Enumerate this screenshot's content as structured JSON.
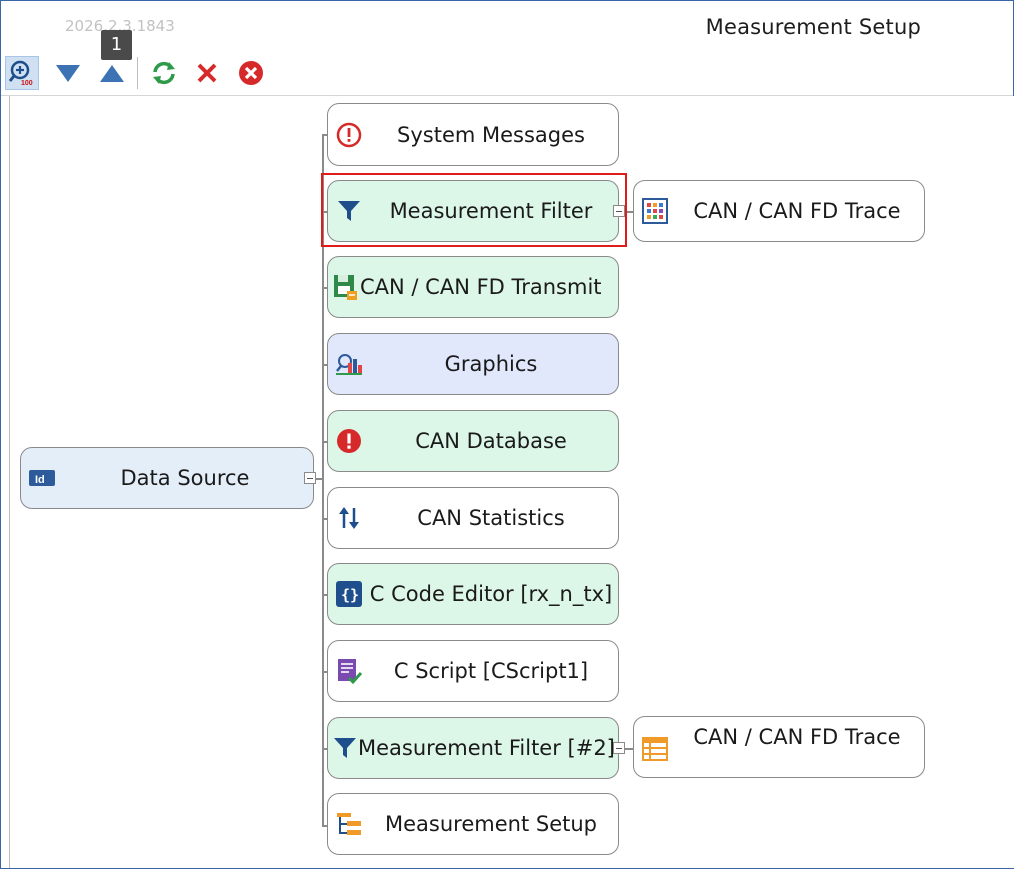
{
  "window": {
    "title": "Measurement Setup",
    "version": "2026.2.3.1843",
    "badge": "1"
  },
  "toolbar": {
    "buttons": [
      {
        "name": "zoom-100-button",
        "icon": "zoom-icon",
        "label": "100"
      },
      {
        "name": "move-down-button",
        "icon": "triangle-down-icon"
      },
      {
        "name": "move-up-button",
        "icon": "triangle-up-icon"
      },
      {
        "name": "refresh-button",
        "icon": "refresh-icon"
      },
      {
        "name": "delete-button",
        "icon": "x-icon"
      },
      {
        "name": "cancel-button",
        "icon": "x-circle-icon"
      }
    ]
  },
  "tree": {
    "root": {
      "label": "Data Source",
      "icon": "id-badge-icon"
    },
    "children": [
      {
        "label": "System Messages",
        "icon": "alert-circle-outline-icon"
      },
      {
        "label": "Measurement Filter",
        "icon": "funnel-icon",
        "child": {
          "label": "CAN / CAN FD Trace",
          "icon": "color-grid-icon"
        }
      },
      {
        "label": "CAN / CAN FD Transmit",
        "icon": "transmit-disk-icon"
      },
      {
        "label": "Graphics",
        "icon": "chart-icon"
      },
      {
        "label": "CAN Database",
        "icon": "alert-circle-filled-icon"
      },
      {
        "label": "CAN Statistics",
        "icon": "sort-arrows-icon"
      },
      {
        "label": "C Code Editor [rx_n_tx]",
        "icon": "braces-icon"
      },
      {
        "label": "C Script [CScript1]",
        "icon": "script-check-icon"
      },
      {
        "label": "Measurement Filter [#2]",
        "icon": "funnel-icon",
        "child": {
          "label": "CAN / CAN FD Trace",
          "icon": "table-icon"
        }
      },
      {
        "label": "Measurement Setup",
        "icon": "tree-setup-icon"
      }
    ]
  },
  "colors": {
    "accent_blue": "#3a66a8",
    "node_green": "#dcf6e8",
    "node_blue": "#e1e8fb",
    "highlight_red": "#e01b1b"
  }
}
